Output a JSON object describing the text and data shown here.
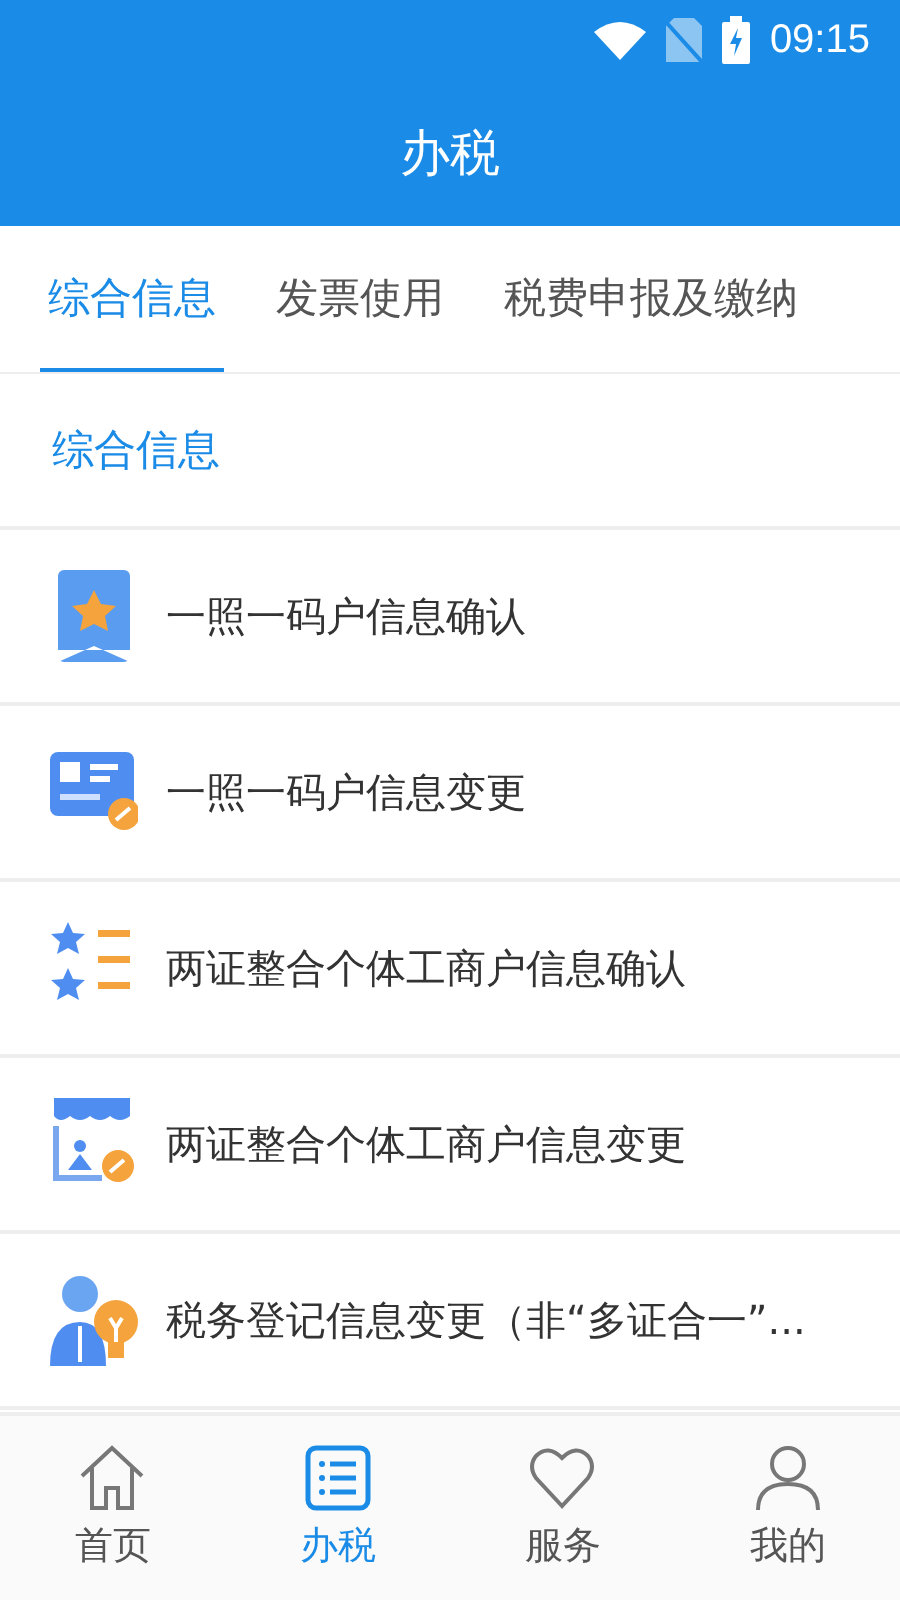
{
  "status_bar": {
    "time": "09:15"
  },
  "header": {
    "title": "办税"
  },
  "tabs": [
    {
      "label": "综合信息",
      "selected": true
    },
    {
      "label": "发票使用",
      "selected": false
    },
    {
      "label": "税费申报及缴纳",
      "selected": false
    }
  ],
  "section": {
    "title": "综合信息"
  },
  "items": [
    {
      "kind": "badge",
      "label": "一照一码户信息确认"
    },
    {
      "kind": "card",
      "label": "一照一码户信息变更"
    },
    {
      "kind": "stars",
      "label": "两证整合个体工商户信息确认"
    },
    {
      "kind": "shop",
      "label": "两证整合个体工商户信息变更"
    },
    {
      "kind": "person",
      "label": "税务登记信息变更（非“多证合一”..."
    }
  ],
  "bottom_nav": [
    {
      "kind": "home",
      "label": "首页",
      "selected": false
    },
    {
      "kind": "list",
      "label": "办税",
      "selected": true
    },
    {
      "kind": "heart",
      "label": "服务",
      "selected": false
    },
    {
      "kind": "user",
      "label": "我的",
      "selected": false
    }
  ]
}
